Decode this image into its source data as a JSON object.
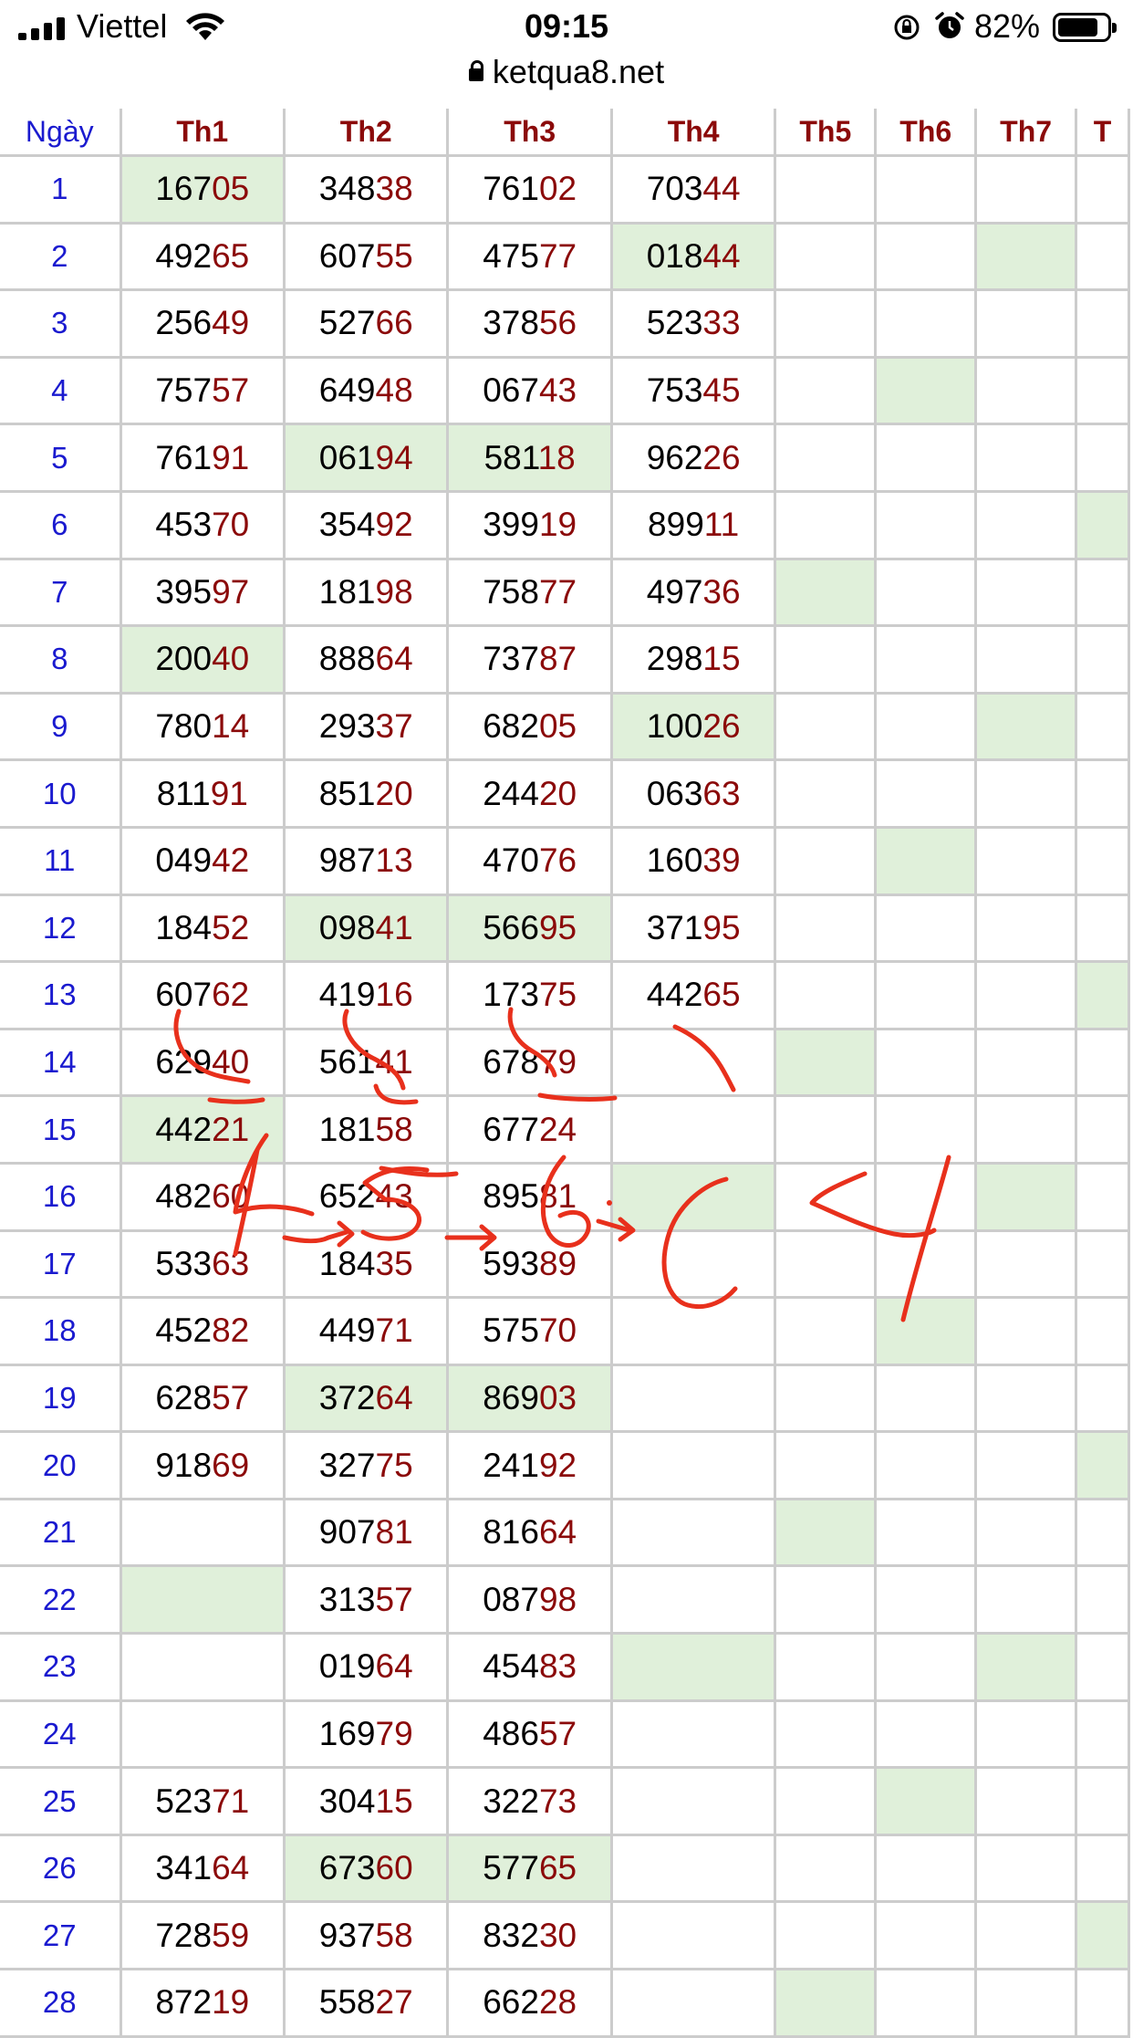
{
  "status_bar": {
    "carrier": "Viettel",
    "time": "09:15",
    "battery_percent": "82%",
    "battery_level": 0.82,
    "icons": [
      "signal-icon",
      "wifi-icon",
      "rotation-lock-icon",
      "alarm-icon",
      "battery-icon"
    ]
  },
  "browser": {
    "url": "ketqua8.net"
  },
  "table": {
    "headers": [
      "Ngày",
      "Th1",
      "Th2",
      "Th3",
      "Th4",
      "Th5",
      "Th6",
      "Th7",
      "T"
    ],
    "rows": [
      {
        "day": "1",
        "cells": [
          [
            "167",
            "05"
          ],
          [
            "348",
            "38"
          ],
          [
            "761",
            "02"
          ],
          [
            "703",
            "44"
          ],
          "",
          "",
          "",
          ""
        ],
        "hl": [
          1
        ]
      },
      {
        "day": "2",
        "cells": [
          [
            "492",
            "65"
          ],
          [
            "607",
            "55"
          ],
          [
            "475",
            "77"
          ],
          [
            "018",
            "44"
          ],
          "",
          "",
          "",
          ""
        ],
        "hl": [
          4,
          7
        ]
      },
      {
        "day": "3",
        "cells": [
          [
            "256",
            "49"
          ],
          [
            "527",
            "66"
          ],
          [
            "378",
            "56"
          ],
          [
            "523",
            "33"
          ],
          "",
          "",
          "",
          ""
        ],
        "hl": []
      },
      {
        "day": "4",
        "cells": [
          [
            "757",
            "57"
          ],
          [
            "649",
            "48"
          ],
          [
            "067",
            "43"
          ],
          [
            "753",
            "45"
          ],
          "",
          "",
          "",
          ""
        ],
        "hl": [
          6
        ]
      },
      {
        "day": "5",
        "cells": [
          [
            "761",
            "91"
          ],
          [
            "061",
            "94"
          ],
          [
            "581",
            "18"
          ],
          [
            "962",
            "26"
          ],
          "",
          "",
          "",
          ""
        ],
        "hl": [
          2,
          3
        ]
      },
      {
        "day": "6",
        "cells": [
          [
            "453",
            "70"
          ],
          [
            "354",
            "92"
          ],
          [
            "399",
            "19"
          ],
          [
            "899",
            "11"
          ],
          "",
          "",
          "",
          ""
        ],
        "hl": [
          8
        ]
      },
      {
        "day": "7",
        "cells": [
          [
            "395",
            "97"
          ],
          [
            "181",
            "98"
          ],
          [
            "758",
            "77"
          ],
          [
            "497",
            "36"
          ],
          "",
          "",
          "",
          ""
        ],
        "hl": [
          5
        ]
      },
      {
        "day": "8",
        "cells": [
          [
            "200",
            "40"
          ],
          [
            "888",
            "64"
          ],
          [
            "737",
            "87"
          ],
          [
            "298",
            "15"
          ],
          "",
          "",
          "",
          ""
        ],
        "hl": [
          1
        ]
      },
      {
        "day": "9",
        "cells": [
          [
            "780",
            "14"
          ],
          [
            "293",
            "37"
          ],
          [
            "682",
            "05"
          ],
          [
            "100",
            "26"
          ],
          "",
          "",
          "",
          ""
        ],
        "hl": [
          4,
          7
        ]
      },
      {
        "day": "10",
        "cells": [
          [
            "811",
            "91"
          ],
          [
            "851",
            "20"
          ],
          [
            "244",
            "20"
          ],
          [
            "063",
            "63"
          ],
          "",
          "",
          "",
          ""
        ],
        "hl": []
      },
      {
        "day": "11",
        "cells": [
          [
            "049",
            "42"
          ],
          [
            "987",
            "13"
          ],
          [
            "470",
            "76"
          ],
          [
            "160",
            "39"
          ],
          "",
          "",
          "",
          ""
        ],
        "hl": [
          6
        ]
      },
      {
        "day": "12",
        "cells": [
          [
            "184",
            "52"
          ],
          [
            "098",
            "41"
          ],
          [
            "566",
            "95"
          ],
          [
            "371",
            "95"
          ],
          "",
          "",
          "",
          ""
        ],
        "hl": [
          2,
          3
        ]
      },
      {
        "day": "13",
        "cells": [
          [
            "607",
            "62"
          ],
          [
            "419",
            "16"
          ],
          [
            "173",
            "75"
          ],
          [
            "442",
            "65"
          ],
          "",
          "",
          "",
          ""
        ],
        "hl": [
          8
        ]
      },
      {
        "day": "14",
        "cells": [
          [
            "629",
            "40"
          ],
          [
            "561",
            "41"
          ],
          [
            "678",
            "79"
          ],
          "",
          "",
          "",
          "",
          ""
        ],
        "hl": [
          5
        ]
      },
      {
        "day": "15",
        "cells": [
          [
            "442",
            "21"
          ],
          [
            "181",
            "58"
          ],
          [
            "677",
            "24"
          ],
          "",
          "",
          "",
          "",
          ""
        ],
        "hl": [
          1
        ]
      },
      {
        "day": "16",
        "cells": [
          [
            "482",
            "60"
          ],
          [
            "652",
            "43"
          ],
          [
            "895",
            "81"
          ],
          "",
          "",
          "",
          "",
          ""
        ],
        "hl": [
          4,
          7
        ]
      },
      {
        "day": "17",
        "cells": [
          [
            "533",
            "63"
          ],
          [
            "184",
            "35"
          ],
          [
            "593",
            "89"
          ],
          "",
          "",
          "",
          "",
          ""
        ],
        "hl": []
      },
      {
        "day": "18",
        "cells": [
          [
            "452",
            "82"
          ],
          [
            "449",
            "71"
          ],
          [
            "575",
            "70"
          ],
          "",
          "",
          "",
          "",
          ""
        ],
        "hl": [
          6
        ]
      },
      {
        "day": "19",
        "cells": [
          [
            "628",
            "57"
          ],
          [
            "372",
            "64"
          ],
          [
            "869",
            "03"
          ],
          "",
          "",
          "",
          "",
          ""
        ],
        "hl": [
          2,
          3
        ]
      },
      {
        "day": "20",
        "cells": [
          [
            "918",
            "69"
          ],
          [
            "327",
            "75"
          ],
          [
            "241",
            "92"
          ],
          "",
          "",
          "",
          "",
          ""
        ],
        "hl": [
          8
        ]
      },
      {
        "day": "21",
        "cells": [
          "",
          [
            "907",
            "81"
          ],
          [
            "816",
            "64"
          ],
          "",
          "",
          "",
          "",
          ""
        ],
        "hl": [
          5
        ]
      },
      {
        "day": "22",
        "cells": [
          "",
          [
            "313",
            "57"
          ],
          [
            "087",
            "98"
          ],
          "",
          "",
          "",
          "",
          ""
        ],
        "hl": [
          1
        ]
      },
      {
        "day": "23",
        "cells": [
          "",
          [
            "019",
            "64"
          ],
          [
            "454",
            "83"
          ],
          "",
          "",
          "",
          "",
          ""
        ],
        "hl": [
          4,
          7
        ]
      },
      {
        "day": "24",
        "cells": [
          "",
          [
            "169",
            "79"
          ],
          [
            "486",
            "57"
          ],
          "",
          "",
          "",
          "",
          ""
        ],
        "hl": []
      },
      {
        "day": "25",
        "cells": [
          [
            "523",
            "71"
          ],
          [
            "304",
            "15"
          ],
          [
            "322",
            "73"
          ],
          "",
          "",
          "",
          "",
          ""
        ],
        "hl": [
          6
        ]
      },
      {
        "day": "26",
        "cells": [
          [
            "341",
            "64"
          ],
          [
            "673",
            "60"
          ],
          [
            "577",
            "65"
          ],
          "",
          "",
          "",
          "",
          ""
        ],
        "hl": [
          2,
          3
        ]
      },
      {
        "day": "27",
        "cells": [
          [
            "728",
            "59"
          ],
          [
            "937",
            "58"
          ],
          [
            "832",
            "30"
          ],
          "",
          "",
          "",
          "",
          ""
        ],
        "hl": [
          8
        ]
      },
      {
        "day": "28",
        "cells": [
          [
            "872",
            "19"
          ],
          [
            "558",
            "27"
          ],
          [
            "662",
            "28"
          ],
          "",
          "",
          "",
          "",
          ""
        ],
        "hl": [
          5
        ]
      }
    ]
  },
  "colors": {
    "header_text": "#8b0a0a",
    "day_text": "#1a1acf",
    "highlight": "#e0f0da",
    "grid": "#cccccc",
    "ink": "#e8301c"
  }
}
